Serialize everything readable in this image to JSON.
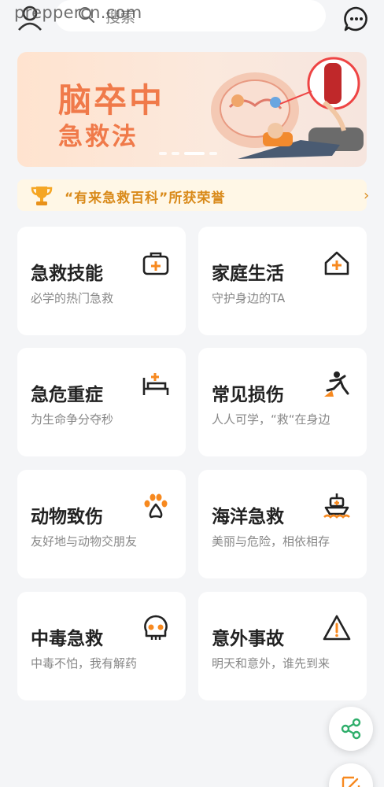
{
  "watermark": "preppercn.com",
  "search": {
    "placeholder": "搜索"
  },
  "banner": {
    "title_line1": "脑卒中",
    "title_line2": "急救法"
  },
  "honor": {
    "text": "“有来急救百科”所获荣誉",
    "chevron": "›"
  },
  "cards": [
    {
      "title": "急救技能",
      "subtitle": "必学的热门急救",
      "icon": "first-aid-kit-icon"
    },
    {
      "title": "家庭生活",
      "subtitle": "守护身边的TA",
      "icon": "home-plus-icon"
    },
    {
      "title": "急危重症",
      "subtitle": "为生命争分夺秒",
      "icon": "hospital-bed-icon"
    },
    {
      "title": "常见损伤",
      "subtitle": "人人可学，“救“在身边",
      "icon": "falling-person-icon"
    },
    {
      "title": "动物致伤",
      "subtitle": "友好地与动物交朋友",
      "icon": "paw-icon"
    },
    {
      "title": "海洋急救",
      "subtitle": "美丽与危险，相依相存",
      "icon": "ship-icon"
    },
    {
      "title": "中毒急救",
      "subtitle": "中毒不怕，我有解药",
      "icon": "skull-icon"
    },
    {
      "title": "意外事故",
      "subtitle": "明天和意外，谁先到来",
      "icon": "warning-icon"
    }
  ],
  "colors": {
    "accent": "#f7891f",
    "banner_text": "#f07a4a",
    "honor_text": "#d98a1a",
    "fab_icon": "#2fae6b"
  }
}
